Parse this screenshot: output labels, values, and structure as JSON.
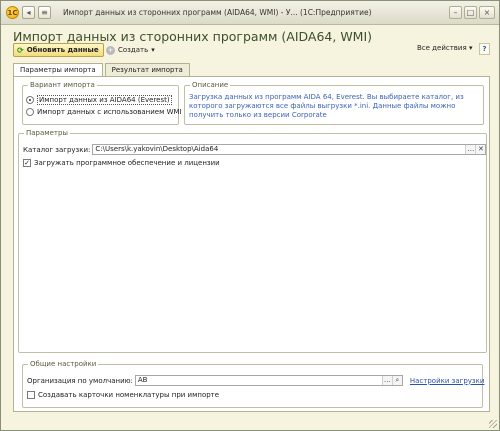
{
  "window": {
    "title": "Импорт данных из сторонних программ (AIDA64, WMI) - У... (1С:Предприятие)",
    "controls": {
      "minimize": "–",
      "maximize": "□",
      "close": "×"
    }
  },
  "form": {
    "title": "Импорт данных из сторонних программ (AIDA64, WMI)"
  },
  "cmdbar": {
    "refresh_label": "Обновить данные",
    "create_label": "Создать",
    "all_actions_label": "Все действия",
    "help_label": "?"
  },
  "tabs": [
    {
      "label": "Параметры импорта",
      "active": true
    },
    {
      "label": "Результат импорта",
      "active": false
    }
  ],
  "import_variant": {
    "title": "Вариант импорта",
    "options": [
      {
        "label": "Импорт данных из AIDA64 (Everest)",
        "selected": true
      },
      {
        "label": "Импорт данных с использованием WMI",
        "selected": false
      }
    ]
  },
  "description": {
    "title": "Описание",
    "text": "Загрузка данных из программ AIDA 64, Everest. Вы выбираете каталог, из которого загружаются все файлы выгрузки *.ini. Данные файлы можно получить только из версии Corporate"
  },
  "parameters": {
    "title": "Параметры",
    "folder_label": "Каталог загрузки:",
    "folder_value": "C:\\Users\\k.yakovin\\Desktop\\Aida64",
    "load_software_label": "Загружать программное обеспечение и лицензии",
    "load_software_checked": true
  },
  "general": {
    "title": "Общие настройки",
    "org_label": "Организация по умолчанию:",
    "org_value": "АВ",
    "load_settings_link": "Настройки загрузки",
    "create_cards_label": "Создавать карточки номенклатуры при импорте",
    "create_cards_checked": false
  }
}
